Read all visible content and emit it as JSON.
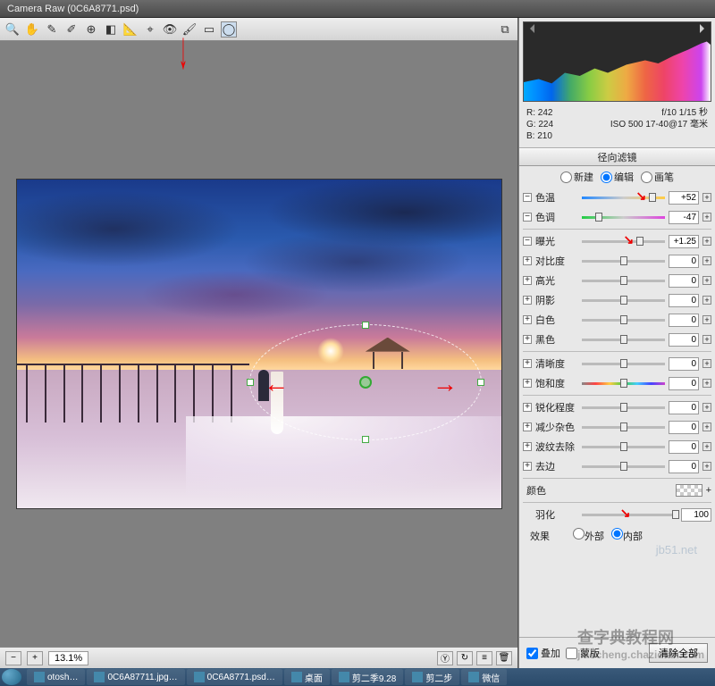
{
  "title": "Camera Raw (0C6A8771.psd)",
  "toolbar_icons": [
    "zoom",
    "hand",
    "eyedrop",
    "eyedrop2",
    "target",
    "crop",
    "straighten",
    "spot",
    "redeye",
    "brush",
    "grad",
    "radial"
  ],
  "histogram": {
    "rgb_r_label": "R:",
    "rgb_r": "242",
    "rgb_g_label": "G:",
    "rgb_g": "224",
    "rgb_b_label": "B:",
    "rgb_b": "210",
    "exposure_meta": "f/10  1/15 秒",
    "iso_meta": "ISO 500  17-40@17 毫米"
  },
  "panel_tab": "径向滤镜",
  "mode": {
    "new": "新建",
    "edit": "编辑",
    "brush": "画笔",
    "selected": "edit"
  },
  "sliders": {
    "temperature": {
      "label": "色温",
      "value": "+52",
      "pos": 85,
      "enabled": true
    },
    "tint": {
      "label": "色调",
      "value": "-47",
      "pos": 20,
      "enabled": true
    },
    "exposure": {
      "label": "曝光",
      "value": "+1.25",
      "pos": 70,
      "enabled": true
    },
    "contrast": {
      "label": "对比度",
      "value": "0",
      "pos": 50,
      "enabled": false
    },
    "highlights": {
      "label": "高光",
      "value": "0",
      "pos": 50,
      "enabled": false
    },
    "shadows": {
      "label": "阴影",
      "value": "0",
      "pos": 50,
      "enabled": false
    },
    "whites": {
      "label": "白色",
      "value": "0",
      "pos": 50,
      "enabled": false
    },
    "blacks": {
      "label": "黑色",
      "value": "0",
      "pos": 50,
      "enabled": false
    },
    "clarity": {
      "label": "清晰度",
      "value": "0",
      "pos": 50,
      "enabled": false
    },
    "saturation": {
      "label": "饱和度",
      "value": "0",
      "pos": 50,
      "enabled": false
    },
    "sharpness": {
      "label": "锐化程度",
      "value": "0",
      "pos": 50,
      "enabled": false
    },
    "noise": {
      "label": "减少杂色",
      "value": "0",
      "pos": 50,
      "enabled": false
    },
    "moire": {
      "label": "波纹去除",
      "value": "0",
      "pos": 50,
      "enabled": false
    },
    "defringe": {
      "label": "去边",
      "value": "0",
      "pos": 50,
      "enabled": false
    }
  },
  "color_label": "颜色",
  "feather": {
    "label": "羽化",
    "value": "100",
    "pos": 98
  },
  "effect": {
    "label": "效果",
    "outside": "外部",
    "inside": "内部",
    "selected": "inside"
  },
  "overlay_cb": "叠加",
  "mask_cb": "蒙版",
  "clear_btn": "清除全部",
  "zoom": "13.1%",
  "watermark_main": "查字典教程网",
  "watermark_sub": "jiaocheng.chazidian.com",
  "wm_small": "jb51.net",
  "taskbar": [
    "otosh…",
    "0C6A87711.jpg…",
    "0C6A8771.psd…",
    "桌面",
    "剪二季9.28",
    "剪二步",
    "微信"
  ]
}
